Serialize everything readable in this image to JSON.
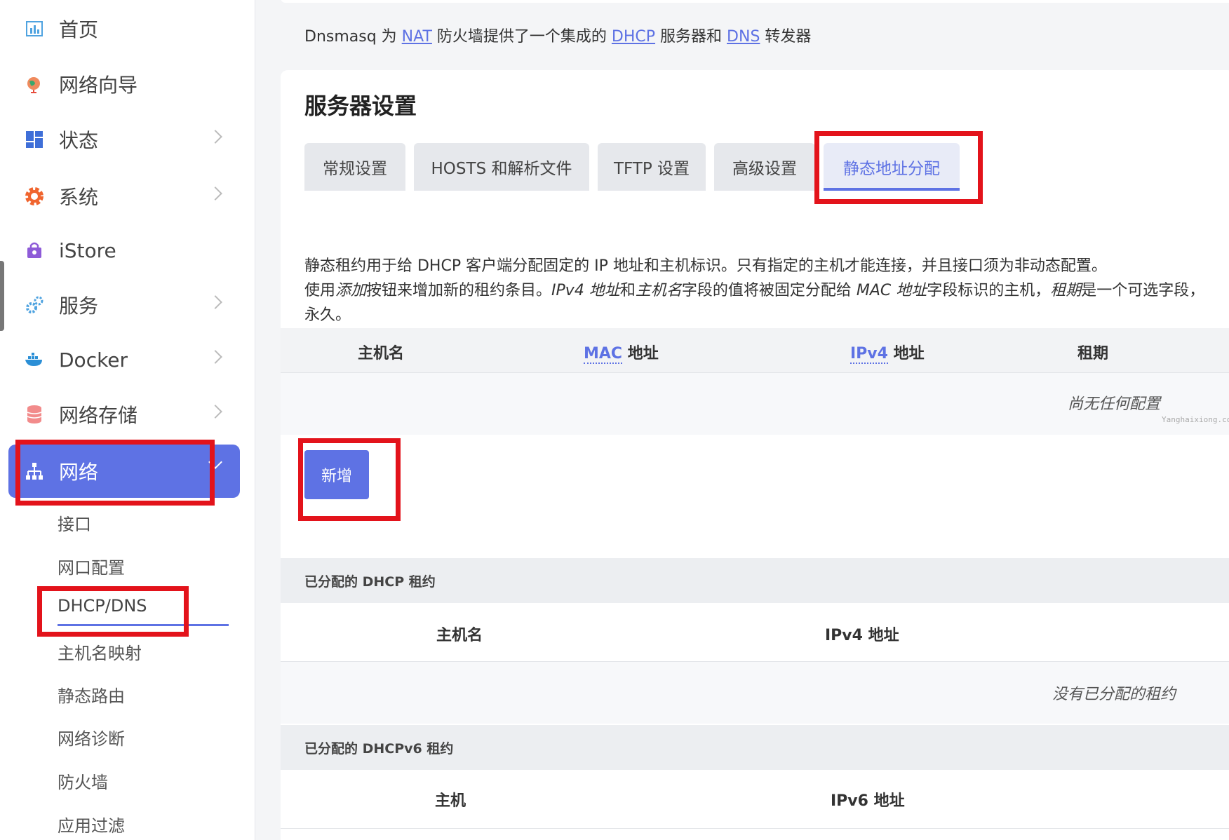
{
  "sidebar": {
    "items": [
      {
        "label": "首页",
        "icon": "dashboard-icon"
      },
      {
        "label": "网络向导",
        "icon": "globe-icon"
      },
      {
        "label": "状态",
        "icon": "grid-icon"
      },
      {
        "label": "系统",
        "icon": "gear-icon"
      },
      {
        "label": "iStore",
        "icon": "store-bag-icon"
      },
      {
        "label": "服务",
        "icon": "services-gears-icon"
      },
      {
        "label": "Docker",
        "icon": "docker-whale-icon"
      },
      {
        "label": "网络存储",
        "icon": "database-icon"
      },
      {
        "label": "网络",
        "icon": "network-tree-icon"
      }
    ],
    "sub_items": [
      "接口",
      "网口配置",
      "DHCP/DNS",
      "主机名映射",
      "静态路由",
      "网络诊断",
      "防火墙",
      "应用过滤"
    ],
    "accent": "#5e72e4"
  },
  "intro": {
    "prefix": "Dnsmasq 为 ",
    "nat": "NAT",
    "mid1": " 防火墙提供了一个集成的 ",
    "dhcp": "DHCP",
    "mid2": " 服务器和 ",
    "dns": "DNS",
    "suffix": " 转发器"
  },
  "card": {
    "title": "服务器设置",
    "tabs": [
      "常规设置",
      "HOSTS 和解析文件",
      "TFTP 设置",
      "高级设置",
      "静态地址分配"
    ],
    "desc_line1": "静态租约用于给 DHCP 客户端分配固定的 IP 地址和主机标识。只有指定的主机才能连接，并且接口须为非动态配置。",
    "desc_line2": {
      "p1": "使用",
      "em1": "添加",
      "p2": "按钮来增加新的租约条目。",
      "em2": "IPv4 地址",
      "p3": "和",
      "em3": "主机名",
      "p4": "字段的值将被固定分配给 ",
      "em4": "MAC 地址",
      "p5": "字段标识的主机，",
      "em5": "租期",
      "p6": "是一个可选字段，"
    },
    "desc_line3": "永久。",
    "static_table": {
      "col_hostname": "主机名",
      "col_mac_abbr": "MAC",
      "col_mac_rest": " 地址",
      "col_ipv4_abbr": "IPv4",
      "col_ipv4_rest": " 地址",
      "col_lease": "租期",
      "empty": "尚无任何配置"
    },
    "add_button": "新增",
    "watermark": "Yanghaixiong.com",
    "dhcp_section": {
      "title": "已分配的 DHCP 租约",
      "col_hostname": "主机名",
      "col_ipv4": "IPv4 地址",
      "empty": "没有已分配的租约"
    },
    "dhcpv6_section": {
      "title": "已分配的 DHCPv6 租约",
      "col_host": "主机",
      "col_ipv6": "IPv6 地址"
    }
  },
  "highlight_color": "#e3131b"
}
